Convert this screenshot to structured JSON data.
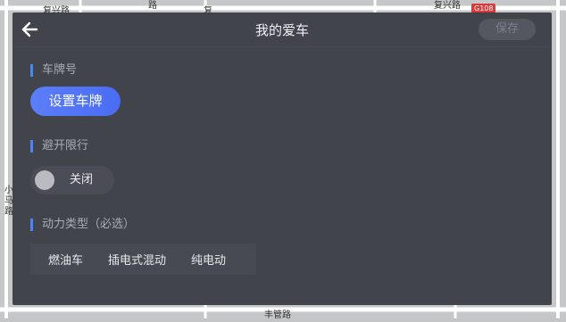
{
  "map": {
    "labels": [
      "复兴路",
      "路",
      "复",
      "复兴路",
      "小",
      "马",
      "路",
      "丰管路"
    ],
    "badge": "G108"
  },
  "header": {
    "back_icon": "arrow-left-icon",
    "title": "我的爱车",
    "save_label": "保存"
  },
  "plate": {
    "section_label": "车牌号",
    "button_label": "设置车牌"
  },
  "restriction": {
    "section_label": "避开限行",
    "toggle_label": "关闭",
    "toggle_on": false
  },
  "power": {
    "section_label": "动力类型（必选）",
    "options": [
      "燃油车",
      "插电式混动",
      "纯电动"
    ]
  },
  "colors": {
    "accent": "#4a6cf3",
    "section_bar": "#4a86f5",
    "panel_bg": "#383a42"
  }
}
